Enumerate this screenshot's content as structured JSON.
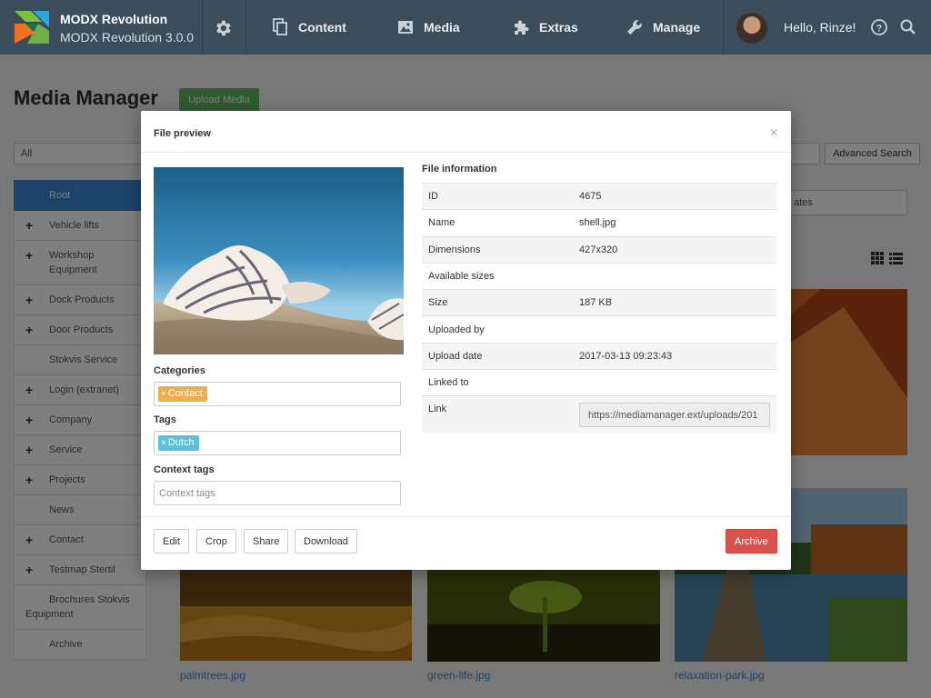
{
  "header": {
    "brand_name": "MODX Revolution",
    "brand_version": "MODX Revolution 3.0.0",
    "nav": [
      {
        "label": "Content",
        "icon": "documents-icon"
      },
      {
        "label": "Media",
        "icon": "image-icon"
      },
      {
        "label": "Extras",
        "icon": "puzzle-icon"
      },
      {
        "label": "Manage",
        "icon": "wrench-icon"
      }
    ],
    "greeting": "Hello, Rinze!"
  },
  "page": {
    "title": "Media Manager",
    "upload_label": "Upload Media",
    "filter_value": "All",
    "advanced_search_label": "Advanced Search",
    "dates_value": "ates"
  },
  "folders": [
    {
      "label": "Root",
      "expandable": false,
      "active": true
    },
    {
      "label": "Vehicle lifts",
      "expandable": true
    },
    {
      "label": "Workshop Equipment",
      "expandable": true
    },
    {
      "label": "Dock Products",
      "expandable": true
    },
    {
      "label": "Door Products",
      "expandable": true
    },
    {
      "label": "Stokvis Service",
      "expandable": false
    },
    {
      "label": "Login (extranet)",
      "expandable": true
    },
    {
      "label": "Company",
      "expandable": true
    },
    {
      "label": "Service",
      "expandable": true
    },
    {
      "label": "Projects",
      "expandable": true
    },
    {
      "label": "News",
      "expandable": false
    },
    {
      "label": "Contact",
      "expandable": true
    },
    {
      "label": "Testmap Stertil",
      "expandable": true
    },
    {
      "label": "Brochures Stokvis Equipment",
      "expandable": false
    },
    {
      "label": "Archive",
      "expandable": false
    }
  ],
  "thumbnails": [
    {
      "name": "palmtrees.jpg"
    },
    {
      "name": "green-life.jpg"
    },
    {
      "name": "relaxation-park.jpg"
    }
  ],
  "modal": {
    "title": "File preview",
    "close": "×",
    "categories_label": "Categories",
    "categories": [
      {
        "label": "Contact",
        "color": "#f0ad4e"
      }
    ],
    "tags_label": "Tags",
    "tags": [
      {
        "label": "Dutch",
        "color": "#5bc0de"
      }
    ],
    "context_tags_label": "Context tags",
    "context_tags_placeholder": "Context tags",
    "info_title": "File information",
    "info": [
      {
        "key": "ID",
        "value": "4675"
      },
      {
        "key": "Name",
        "value": "shell.jpg"
      },
      {
        "key": "Dimensions",
        "value": "427x320"
      },
      {
        "key": "Available sizes",
        "value": ""
      },
      {
        "key": "Size",
        "value": "187 KB"
      },
      {
        "key": "Uploaded by",
        "value": ""
      },
      {
        "key": "Upload date",
        "value": "2017-03-13 09:23:43"
      },
      {
        "key": "Linked to",
        "value": ""
      }
    ],
    "link_label": "Link",
    "link_value": "https://mediamanager.ext/uploads/201",
    "buttons": {
      "edit": "Edit",
      "crop": "Crop",
      "share": "Share",
      "download": "Download",
      "archive": "Archive"
    }
  }
}
